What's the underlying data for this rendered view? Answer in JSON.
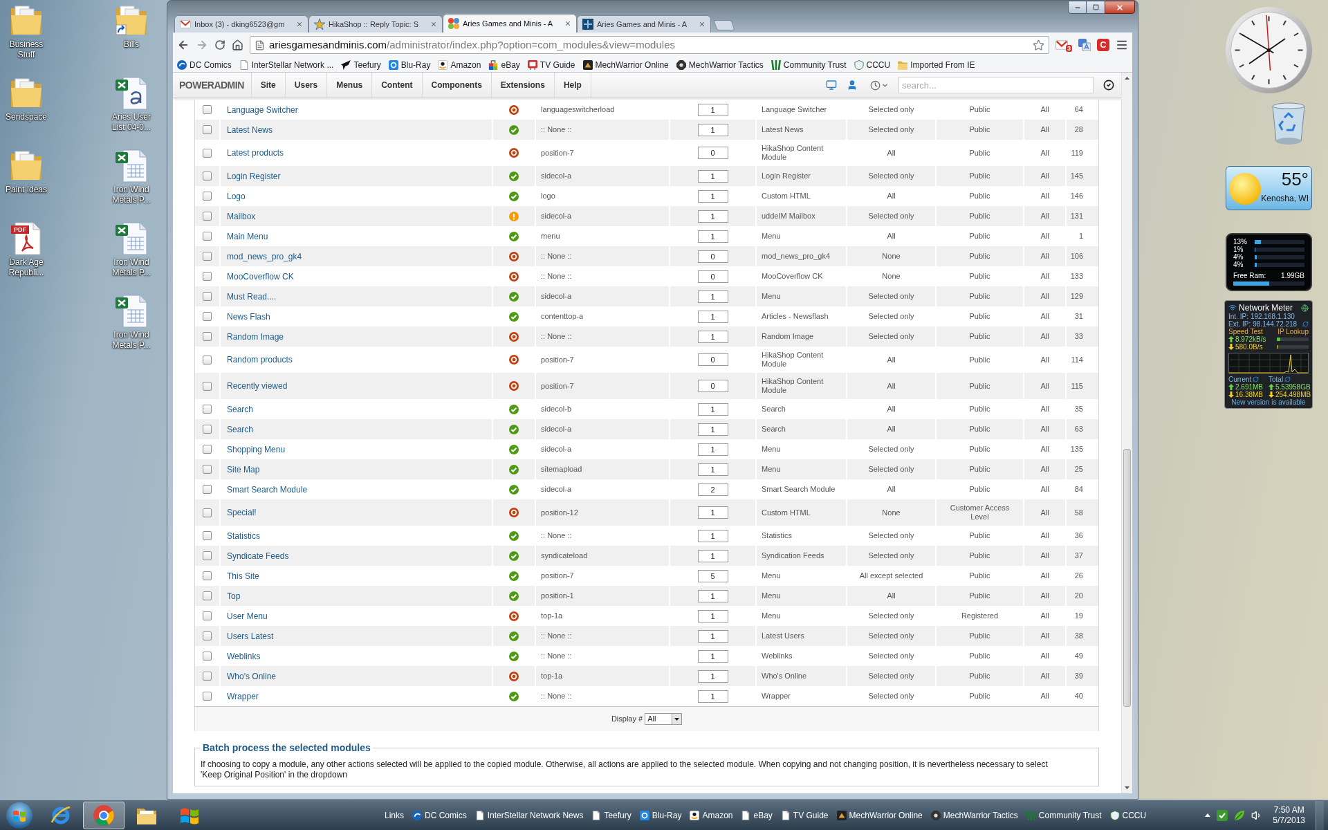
{
  "desktop": {
    "icon_columns": [
      {
        "icons": [
          {
            "label": "Business Stuff",
            "kind": "folder"
          },
          {
            "label": "Sendspace",
            "kind": "folder"
          },
          {
            "label": "Paint Ideas",
            "kind": "folder"
          },
          {
            "label": "Dark Age Republi...",
            "kind": "pdf",
            "badge": "PDF"
          }
        ]
      },
      {
        "icons": [
          {
            "label": "Bills",
            "kind": "folder-shortcut"
          },
          {
            "label": "Aries User List 04-0...",
            "kind": "csv"
          },
          {
            "label": "Iron Wind Metals P...",
            "kind": "spreadsheet"
          },
          {
            "label": "Iron Wind Metals P...",
            "kind": "spreadsheet"
          },
          {
            "label": "Iron Wind Metals P...",
            "kind": "spreadsheet"
          }
        ]
      }
    ]
  },
  "gadgets": {
    "weather": {
      "temperature": "55°",
      "location": "Kenosha, WI"
    },
    "cpu_meter": {
      "cores": [
        {
          "reading": "13%",
          "level": 0.13
        },
        {
          "reading": "1%",
          "level": 0.01
        },
        {
          "reading": "4%",
          "level": 0.04
        },
        {
          "reading": "4%",
          "level": 0.04
        }
      ],
      "ram": {
        "label": "Free Ram:",
        "reading": "1.99GB",
        "level": 0.5
      }
    },
    "network_meter": {
      "title": "Network Meter",
      "internal_ip": {
        "label": "Int. IP:",
        "value": "192.168.1.130"
      },
      "external_ip": {
        "label": "Ext. IP:",
        "value": "98.144.72.218"
      },
      "speed_test": "Speed Test",
      "ip_lookup": "IP Lookup",
      "upload": {
        "reading": "8.972kB/s",
        "level": 0.1
      },
      "download": {
        "reading": "580.0B/s",
        "level": 0.02
      },
      "current": {
        "label": "Current",
        "upload": "2.691MB",
        "download": "16.38MB"
      },
      "total": {
        "label": "Total",
        "upload": "5.53958GB",
        "download": "254.498MB"
      },
      "notice": "New version is available"
    }
  },
  "browser": {
    "tabs": [
      {
        "title": "Inbox (3) - dking6523@gm",
        "kind": "mail",
        "selected": false
      },
      {
        "title": "HikaShop :: Reply Topic: S",
        "kind": "hikashop",
        "selected": false
      },
      {
        "title": "Aries Games and Minis - A",
        "kind": "joomla",
        "selected": true
      },
      {
        "title": "Aries Games and Minis - A",
        "kind": "site",
        "selected": false
      }
    ],
    "address": {
      "host": "ariesgamesandminis.com",
      "path": "/administrator/index.php?option=com_modules&view=modules"
    },
    "extensions": [
      {
        "kind": "mail",
        "badge": "3"
      },
      {
        "kind": "translate"
      },
      {
        "kind": "letter",
        "label": "C"
      }
    ],
    "bookmarks": [
      {
        "label": "DC Comics",
        "kind": "dc"
      },
      {
        "label": "InterStellar Network ...",
        "kind": "page"
      },
      {
        "label": "Teefury",
        "kind": "tee"
      },
      {
        "label": "Blu-Ray",
        "kind": "bluray"
      },
      {
        "label": "Amazon",
        "kind": "amazon"
      },
      {
        "label": "eBay",
        "kind": "ebay"
      },
      {
        "label": "TV Guide",
        "kind": "tvguide"
      },
      {
        "label": "MechWarrior Online",
        "kind": "mwo"
      },
      {
        "label": "MechWarrior Tactics",
        "kind": "mwt"
      },
      {
        "label": "Community Trust",
        "kind": "trust"
      },
      {
        "label": "CCCU",
        "kind": "shield"
      },
      {
        "label": "Imported From IE",
        "kind": "folder"
      }
    ]
  },
  "admin": {
    "logo": "POWERADMIN",
    "menu": [
      "Site",
      "Users",
      "Menus",
      "Content",
      "Components",
      "Extensions",
      "Help"
    ],
    "search": {
      "placeholder": "search..."
    }
  },
  "modules": {
    "rows": [
      {
        "name": "Language Switcher",
        "checked": false,
        "published": false,
        "expired": false,
        "position": "languageswitcherload",
        "order": "1",
        "type": "Language Switcher",
        "pages": "Selected only",
        "access": "Public",
        "language": "All",
        "id": "64"
      },
      {
        "name": "Latest News",
        "checked": false,
        "published": true,
        "expired": false,
        "position": ":: None ::",
        "order": "1",
        "type": "Latest News",
        "pages": "Selected only",
        "access": "Public",
        "language": "All",
        "id": "28"
      },
      {
        "name": "Latest products",
        "checked": false,
        "published": false,
        "expired": false,
        "position": "position-7",
        "order": "0",
        "type": "HikaShop Content Module",
        "pages": "All",
        "access": "Public",
        "language": "All",
        "id": "119"
      },
      {
        "name": "Login Register",
        "checked": false,
        "published": true,
        "expired": false,
        "position": "sidecol-a",
        "order": "1",
        "type": "Login Register",
        "pages": "Selected only",
        "access": "Public",
        "language": "All",
        "id": "145"
      },
      {
        "name": "Logo",
        "checked": false,
        "published": true,
        "expired": false,
        "position": "logo",
        "order": "1",
        "type": "Custom HTML",
        "pages": "All",
        "access": "Public",
        "language": "All",
        "id": "146"
      },
      {
        "name": "Mailbox",
        "checked": false,
        "published": true,
        "expired": true,
        "position": "sidecol-a",
        "order": "1",
        "type": "uddeIM Mailbox",
        "pages": "Selected only",
        "access": "Public",
        "language": "All",
        "id": "131"
      },
      {
        "name": "Main Menu",
        "checked": false,
        "published": true,
        "expired": false,
        "position": "menu",
        "order": "1",
        "type": "Menu",
        "pages": "All",
        "access": "Public",
        "language": "All",
        "id": "1"
      },
      {
        "name": "mod_news_pro_gk4",
        "checked": false,
        "published": false,
        "expired": false,
        "position": ":: None ::",
        "order": "0",
        "type": "mod_news_pro_gk4",
        "pages": "None",
        "access": "Public",
        "language": "All",
        "id": "106"
      },
      {
        "name": "MooCoverflow CK",
        "checked": false,
        "published": false,
        "expired": false,
        "position": ":: None ::",
        "order": "0",
        "type": "MooCoverflow CK",
        "pages": "None",
        "access": "Public",
        "language": "All",
        "id": "133"
      },
      {
        "name": "Must Read....",
        "checked": false,
        "published": true,
        "expired": false,
        "position": "sidecol-a",
        "order": "1",
        "type": "Menu",
        "pages": "Selected only",
        "access": "Public",
        "language": "All",
        "id": "129"
      },
      {
        "name": "News Flash",
        "checked": false,
        "published": true,
        "expired": false,
        "position": "contenttop-a",
        "order": "1",
        "type": "Articles - Newsflash",
        "pages": "Selected only",
        "access": "Public",
        "language": "All",
        "id": "31"
      },
      {
        "name": "Random Image",
        "checked": false,
        "published": false,
        "expired": false,
        "position": ":: None ::",
        "order": "1",
        "type": "Random Image",
        "pages": "Selected only",
        "access": "Public",
        "language": "All",
        "id": "33"
      },
      {
        "name": "Random products",
        "checked": false,
        "published": false,
        "expired": false,
        "position": "position-7",
        "order": "0",
        "type": "HikaShop Content Module",
        "pages": "All",
        "access": "Public",
        "language": "All",
        "id": "114"
      },
      {
        "name": "Recently viewed",
        "checked": false,
        "published": false,
        "expired": false,
        "position": "position-7",
        "order": "0",
        "type": "HikaShop Content Module",
        "pages": "All",
        "access": "Public",
        "language": "All",
        "id": "115"
      },
      {
        "name": "Search",
        "checked": false,
        "published": true,
        "expired": false,
        "position": "sidecol-b",
        "order": "1",
        "type": "Search",
        "pages": "All",
        "access": "Public",
        "language": "All",
        "id": "35"
      },
      {
        "name": "Search",
        "checked": false,
        "published": true,
        "expired": false,
        "position": "sidecol-a",
        "order": "1",
        "type": "Search",
        "pages": "All",
        "access": "Public",
        "language": "All",
        "id": "63"
      },
      {
        "name": "Shopping Menu",
        "checked": false,
        "published": true,
        "expired": false,
        "position": "sidecol-a",
        "order": "1",
        "type": "Menu",
        "pages": "Selected only",
        "access": "Public",
        "language": "All",
        "id": "135"
      },
      {
        "name": "Site Map",
        "checked": false,
        "published": true,
        "expired": false,
        "position": "sitemapload",
        "order": "1",
        "type": "Menu",
        "pages": "Selected only",
        "access": "Public",
        "language": "All",
        "id": "25"
      },
      {
        "name": "Smart Search Module",
        "checked": false,
        "published": true,
        "expired": false,
        "position": "sidecol-a",
        "order": "2",
        "type": "Smart Search Module",
        "pages": "All",
        "access": "Public",
        "language": "All",
        "id": "84"
      },
      {
        "name": "Special!",
        "checked": false,
        "published": false,
        "expired": false,
        "position": "position-12",
        "order": "1",
        "type": "Custom HTML",
        "pages": "None",
        "access": "Customer Access Level",
        "language": "All",
        "id": "58"
      },
      {
        "name": "Statistics",
        "checked": false,
        "published": true,
        "expired": false,
        "position": ":: None ::",
        "order": "1",
        "type": "Statistics",
        "pages": "Selected only",
        "access": "Public",
        "language": "All",
        "id": "36"
      },
      {
        "name": "Syndicate Feeds",
        "checked": false,
        "published": true,
        "expired": false,
        "position": "syndicateload",
        "order": "1",
        "type": "Syndication Feeds",
        "pages": "Selected only",
        "access": "Public",
        "language": "All",
        "id": "37"
      },
      {
        "name": "This Site",
        "checked": false,
        "published": true,
        "expired": false,
        "position": "position-7",
        "order": "5",
        "type": "Menu",
        "pages": "All except selected",
        "access": "Public",
        "language": "All",
        "id": "26"
      },
      {
        "name": "Top",
        "checked": false,
        "published": true,
        "expired": false,
        "position": "position-1",
        "order": "1",
        "type": "Menu",
        "pages": "All",
        "access": "Public",
        "language": "All",
        "id": "20"
      },
      {
        "name": "User Menu",
        "checked": false,
        "published": false,
        "expired": false,
        "position": "top-1a",
        "order": "1",
        "type": "Menu",
        "pages": "Selected only",
        "access": "Registered",
        "language": "All",
        "id": "19"
      },
      {
        "name": "Users Latest",
        "checked": false,
        "published": true,
        "expired": false,
        "position": ":: None ::",
        "order": "1",
        "type": "Latest Users",
        "pages": "Selected only",
        "access": "Public",
        "language": "All",
        "id": "38"
      },
      {
        "name": "Weblinks",
        "checked": false,
        "published": true,
        "expired": false,
        "position": ":: None ::",
        "order": "1",
        "type": "Weblinks",
        "pages": "Selected only",
        "access": "Public",
        "language": "All",
        "id": "49"
      },
      {
        "name": "Who's Online",
        "checked": false,
        "published": false,
        "expired": false,
        "position": "top-1a",
        "order": "1",
        "type": "Who's Online",
        "pages": "Selected only",
        "access": "Public",
        "language": "All",
        "id": "39"
      },
      {
        "name": "Wrapper",
        "checked": false,
        "published": true,
        "expired": false,
        "position": ":: None ::",
        "order": "1",
        "type": "Wrapper",
        "pages": "Selected only",
        "access": "Public",
        "language": "All",
        "id": "40"
      }
    ],
    "display": {
      "label": "Display #",
      "value": "All"
    }
  },
  "batch": {
    "legend": "Batch process the selected modules",
    "text": "If choosing to copy a module, any other actions selected will be applied to the copied module. Otherwise, all actions are applied to the selected module. When copying and not changing position, it is nevertheless necessary to select 'Keep Original Position' in the dropdown"
  },
  "taskbar": {
    "pinned": [
      {
        "kind": "ie",
        "selected": false
      },
      {
        "kind": "chrome",
        "selected": true
      },
      {
        "kind": "explorer",
        "selected": false
      },
      {
        "kind": "media",
        "selected": false
      }
    ],
    "links_label": "Links",
    "links": [
      {
        "label": "DC Comics",
        "kind": "dc"
      },
      {
        "label": "InterStellar Network News",
        "kind": "page"
      },
      {
        "label": "Teefury",
        "kind": "page"
      },
      {
        "label": "Blu-Ray",
        "kind": "bluray"
      },
      {
        "label": "Amazon",
        "kind": "amazon"
      },
      {
        "label": "eBay",
        "kind": "page"
      },
      {
        "label": "TV Guide",
        "kind": "page"
      },
      {
        "label": "MechWarrior Online",
        "kind": "mwo"
      },
      {
        "label": "MechWarrior Tactics",
        "kind": "mwt"
      },
      {
        "label": "Community Trust",
        "kind": "trust"
      },
      {
        "label": "CCCU",
        "kind": "shield"
      }
    ],
    "time": "7:50 AM",
    "date": "5/7/2013"
  }
}
